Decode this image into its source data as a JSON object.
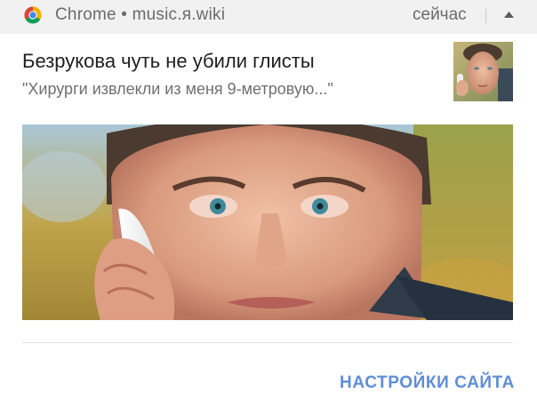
{
  "notification": {
    "app_name": "Chrome",
    "separator": "•",
    "source": "music.я.wiki",
    "time": "сейчас",
    "title": "Безрукова чуть не убили глисты",
    "text": "\"Хирурги извлекли из меня 9-метровую...\"",
    "action_label": "НАСТРОЙКИ САЙТА"
  },
  "icons": {
    "app": "chrome-icon",
    "expand": "chevron-up-icon"
  },
  "colors": {
    "header_bg": "#f1f1f1",
    "action": "#5e8ed6"
  }
}
